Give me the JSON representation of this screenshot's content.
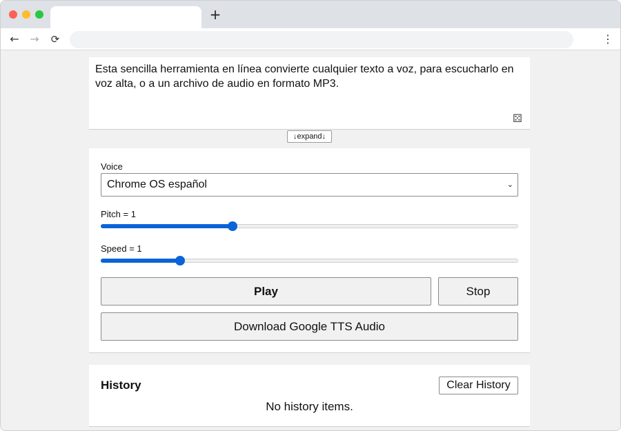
{
  "browser": {
    "new_tab_label": "+",
    "back_glyph": "←",
    "forward_glyph": "→",
    "reload_glyph": "⟳",
    "menu_glyph": "⋮"
  },
  "text_input": {
    "value": "Esta sencilla herramienta en línea convierte cualquier texto a voz, para escucharlo en voz alta, o a un archivo de audio en formato MP3.",
    "dice_icon": "⚄"
  },
  "expand_button": {
    "label": "↓expand↓"
  },
  "voice": {
    "label": "Voice",
    "selected": "Chrome OS español",
    "chevron": "⌄"
  },
  "pitch": {
    "label": "Pitch = 1",
    "value": 1,
    "min": 0,
    "max": 2,
    "fraction": 0.315
  },
  "speed": {
    "label": "Speed = 1",
    "value": 1,
    "min": 0.1,
    "max": 10,
    "fraction": 0.19
  },
  "buttons": {
    "play": "Play",
    "stop": "Stop",
    "download": "Download Google TTS Audio"
  },
  "history": {
    "title": "History",
    "clear_label": "Clear History",
    "empty_text": "No history items."
  },
  "colors": {
    "accent": "#0b63d8",
    "page_bg": "#f1f1f1",
    "card_bg": "#ffffff"
  }
}
